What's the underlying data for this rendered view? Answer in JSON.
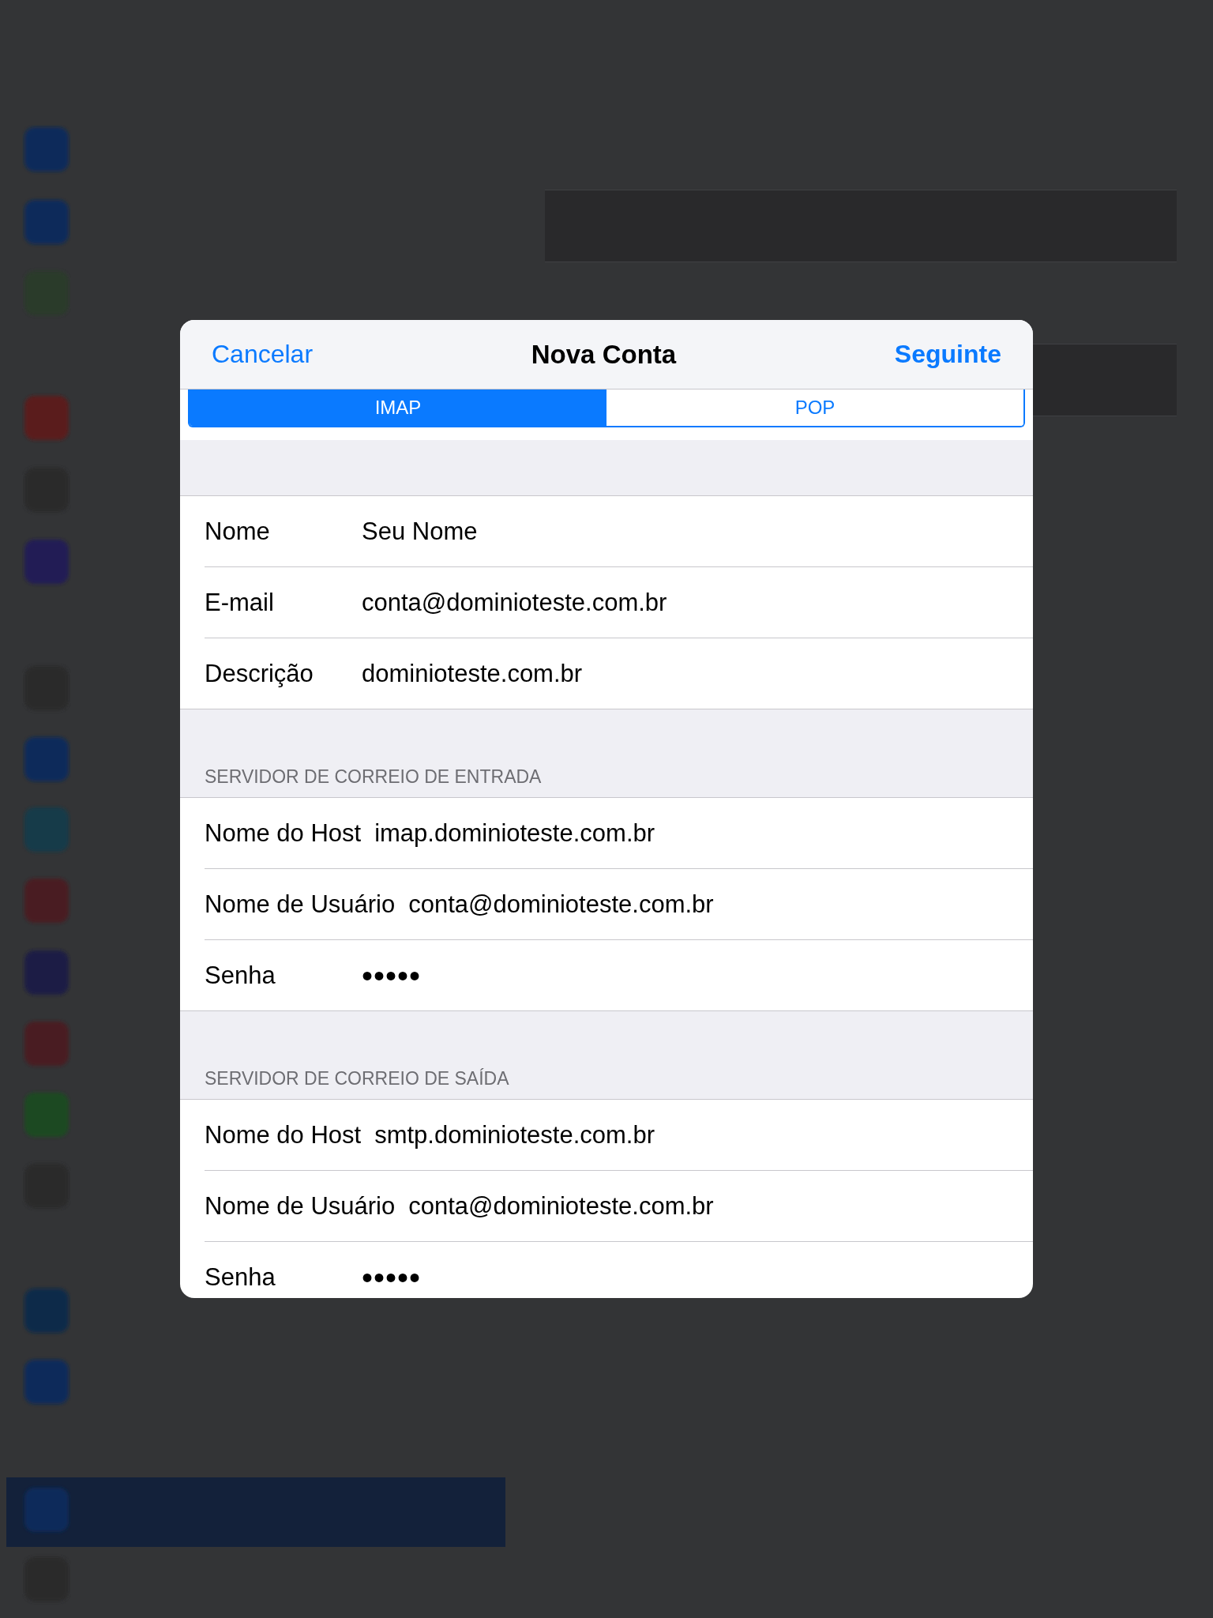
{
  "header": {
    "cancel": "Cancelar",
    "title": "Nova Conta",
    "next": "Seguinte"
  },
  "segments": [
    {
      "label": "IMAP",
      "selected": true
    },
    {
      "label": "POP",
      "selected": false
    }
  ],
  "sections": [
    {
      "rows": [
        {
          "label": "Nome",
          "value": "Seu Nome",
          "kind": "text"
        },
        {
          "label": "E-mail",
          "value": "conta@dominioteste.com.br",
          "kind": "text"
        },
        {
          "label": "Descrição",
          "value": "dominioteste.com.br",
          "kind": "text"
        }
      ]
    },
    {
      "header": "SERVIDOR DE CORREIO DE ENTRADA",
      "rows": [
        {
          "label": "Nome do Host",
          "value": "imap.dominioteste.com.br",
          "kind": "text"
        },
        {
          "label": "Nome de Usuário",
          "value": "conta@dominioteste.com.br",
          "kind": "text"
        },
        {
          "label": "Senha",
          "value": "•••••",
          "kind": "secure"
        }
      ]
    },
    {
      "header": "SERVIDOR DE CORREIO DE SAÍDA",
      "rows": [
        {
          "label": "Nome do Host",
          "value": "smtp.dominioteste.com.br",
          "kind": "text"
        },
        {
          "label": "Nome de Usuário",
          "value": "conta@dominioteste.com.br",
          "kind": "text"
        },
        {
          "label": "Senha",
          "value": "•••••",
          "kind": "secure"
        }
      ]
    }
  ]
}
